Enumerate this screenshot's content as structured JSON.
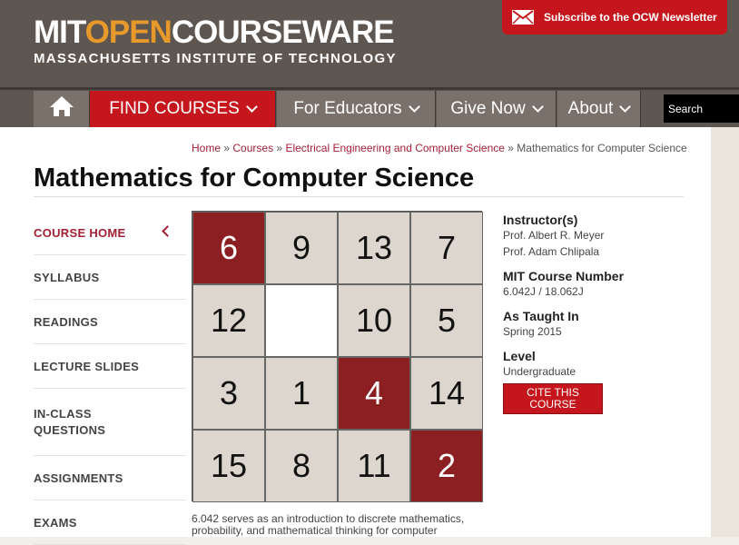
{
  "header": {
    "logo_mit": "MIT",
    "logo_open": "OPEN",
    "logo_courseware": "COURSEWARE",
    "logo_sub": "MASSACHUSETTS INSTITUTE OF TECHNOLOGY",
    "newsletter_label": "Subscribe to the OCW Newsletter"
  },
  "nav": {
    "items": [
      {
        "label": "FIND COURSES"
      },
      {
        "label": "For Educators"
      },
      {
        "label": "Give Now"
      },
      {
        "label": "About"
      }
    ],
    "search_placeholder": "Search"
  },
  "breadcrumb": {
    "home": "Home",
    "sep": "»",
    "courses": "Courses",
    "dept": "Electrical Engineering and Computer Science",
    "current": "Mathematics for Computer Science"
  },
  "page_title": "Mathematics for Computer Science",
  "sidenav": [
    {
      "label": "COURSE HOME"
    },
    {
      "label": "SYLLABUS"
    },
    {
      "label": "READINGS"
    },
    {
      "label": "LECTURE SLIDES"
    },
    {
      "label": "IN-CLASS QUESTIONS"
    },
    {
      "label": "ASSIGNMENTS"
    },
    {
      "label": "EXAMS"
    }
  ],
  "puzzle": {
    "tiles": [
      "6",
      "9",
      "13",
      "7",
      "12",
      "",
      "10",
      "5",
      "3",
      "1",
      "4",
      "14",
      "15",
      "8",
      "11",
      "2"
    ]
  },
  "description": "6.042 serves as an introduction to discrete mathematics, probability, and mathematical thinking for computer",
  "info": {
    "instructor_label": "Instructor(s)",
    "instructors": [
      "Prof. Albert R. Meyer",
      "Prof. Adam Chlipala"
    ],
    "number_label": "MIT Course Number",
    "number": "6.042J / 18.062J",
    "taught_label": "As Taught In",
    "taught": "Spring 2015",
    "level_label": "Level",
    "level": "Undergraduate",
    "cite_label": "CITE THIS COURSE"
  },
  "colors": {
    "brand_red": "#c4161c",
    "tile_red": "#8b1f22",
    "tile_gray": "#dcd6cf",
    "header_bg": "#5e5650"
  }
}
